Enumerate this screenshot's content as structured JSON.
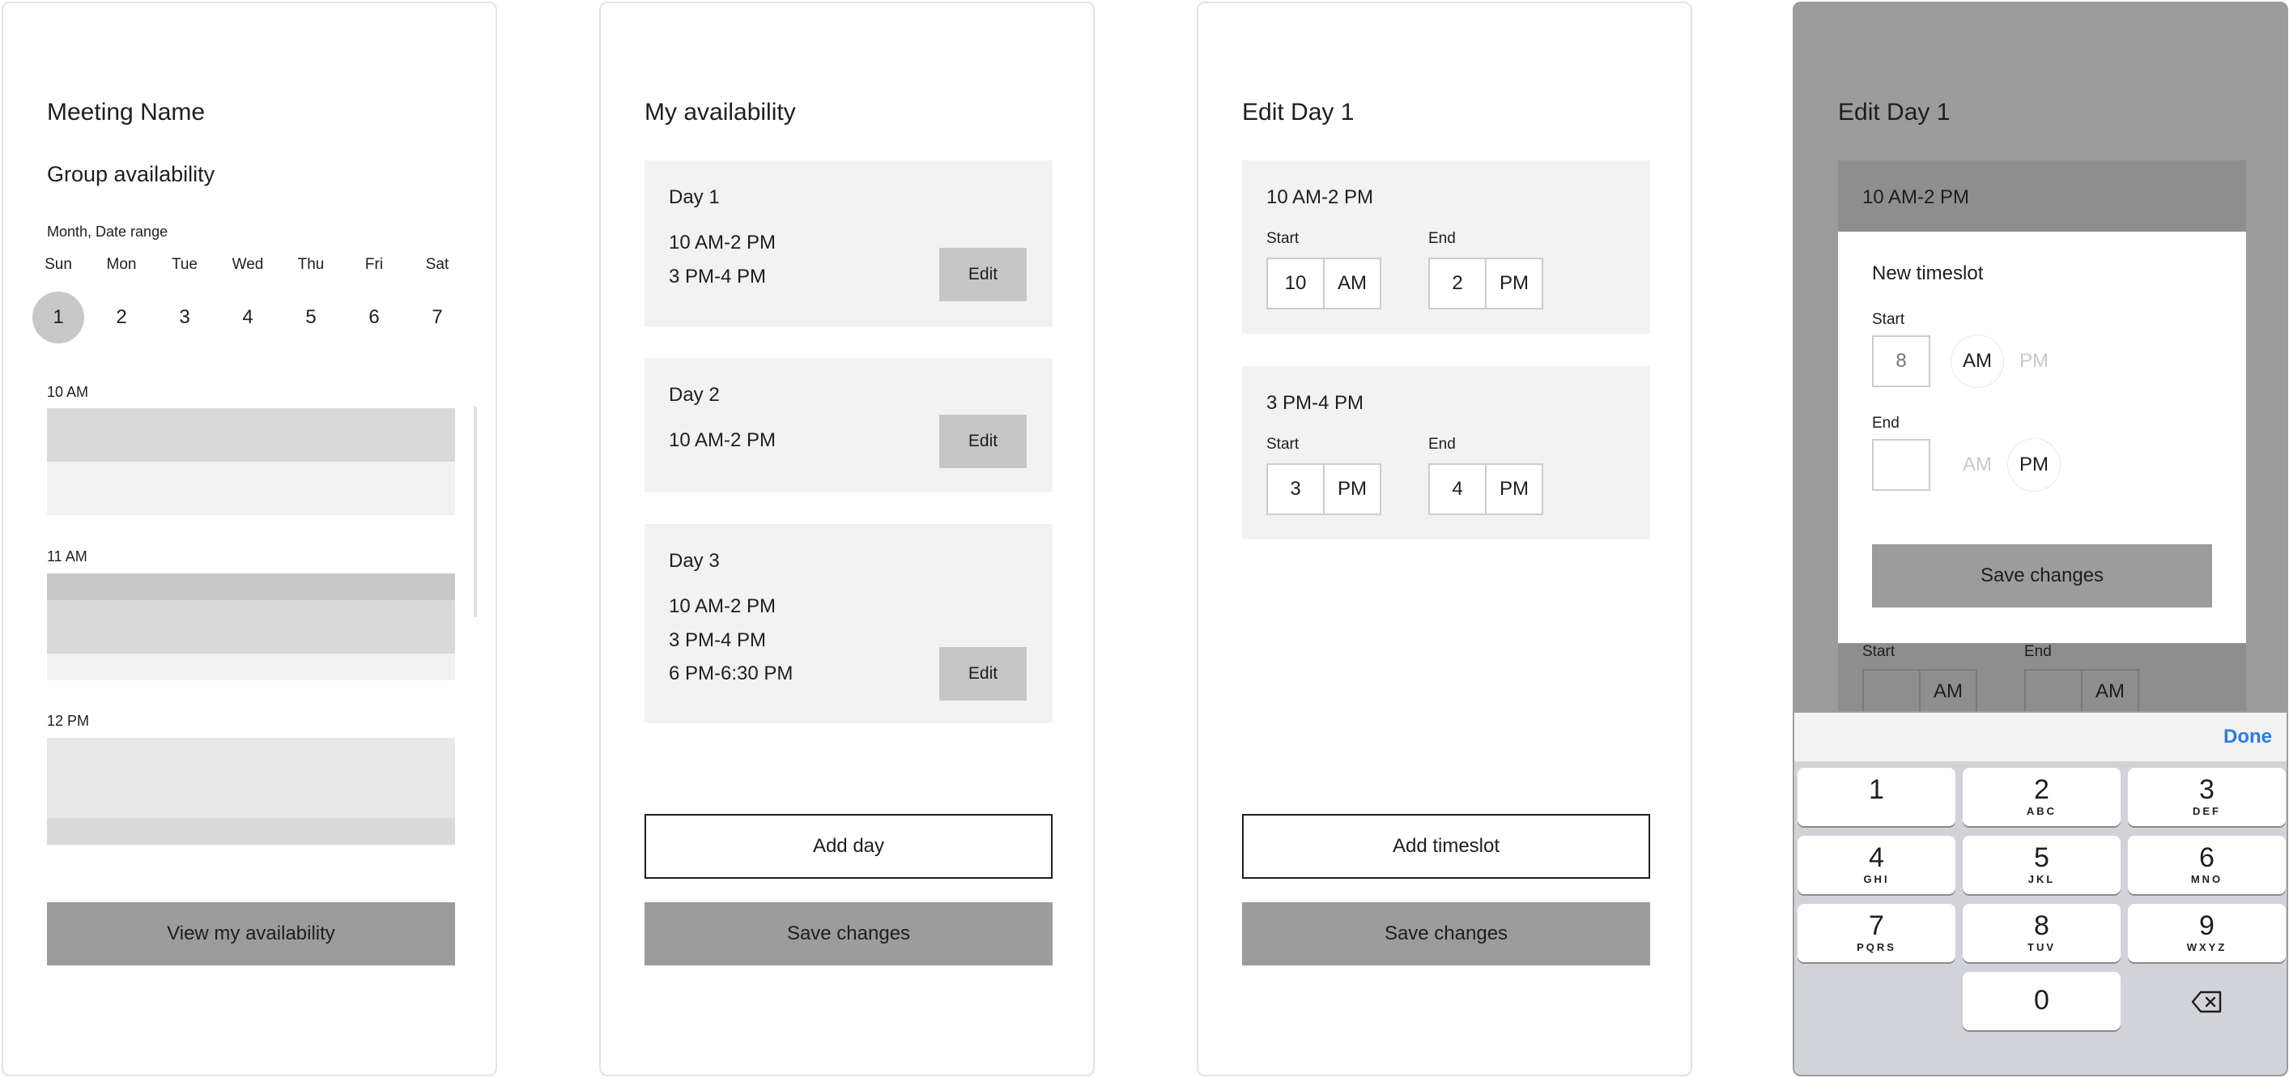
{
  "screen1": {
    "title": "Meeting Name",
    "subtitle": "Group availability",
    "range_label": "Month, Date range",
    "weekdays": [
      "Sun",
      "Mon",
      "Tue",
      "Wed",
      "Thu",
      "Fri",
      "Sat"
    ],
    "dates": [
      "1",
      "2",
      "3",
      "4",
      "5",
      "6",
      "7"
    ],
    "selected_date": "1",
    "hours": [
      "10 AM",
      "11 AM",
      "12 PM"
    ],
    "button": "View my availability"
  },
  "screen2": {
    "title": "My availability",
    "days": [
      {
        "name": "Day 1",
        "slots": [
          "10 AM-2 PM",
          "3 PM-4 PM"
        ],
        "edit": "Edit"
      },
      {
        "name": "Day 2",
        "slots": [
          "10 AM-2 PM"
        ],
        "edit": "Edit"
      },
      {
        "name": "Day 3",
        "slots": [
          "10 AM-2 PM",
          "3 PM-4 PM",
          "6 PM-6:30 PM"
        ],
        "edit": "Edit"
      }
    ],
    "add_button": "Add day",
    "save_button": "Save changes"
  },
  "screen3": {
    "title": "Edit Day 1",
    "slots": [
      {
        "label": "10 AM-2 PM",
        "start_label": "Start",
        "start_hour": "10",
        "start_period": "AM",
        "end_label": "End",
        "end_hour": "2",
        "end_period": "PM"
      },
      {
        "label": "3 PM-4 PM",
        "start_label": "Start",
        "start_hour": "3",
        "start_period": "PM",
        "end_label": "End",
        "end_hour": "4",
        "end_period": "PM"
      }
    ],
    "add_button": "Add timeslot",
    "save_button": "Save changes"
  },
  "screen4": {
    "title": "Edit Day 1",
    "slot_label": "10 AM-2 PM",
    "behind": {
      "start_label": "Start",
      "start_period": "AM",
      "end_label": "End",
      "end_period": "AM"
    },
    "modal": {
      "title": "New timeslot",
      "start_label": "Start",
      "start_value": "8",
      "start_am": "AM",
      "start_pm": "PM",
      "end_label": "End",
      "end_value": "",
      "end_am": "AM",
      "end_pm": "PM",
      "save_button": "Save changes"
    },
    "keyboard": {
      "done": "Done",
      "keys": [
        {
          "n": "1",
          "l": ""
        },
        {
          "n": "2",
          "l": "ABC"
        },
        {
          "n": "3",
          "l": "DEF"
        },
        {
          "n": "4",
          "l": "GHI"
        },
        {
          "n": "5",
          "l": "JKL"
        },
        {
          "n": "6",
          "l": "MNO"
        },
        {
          "n": "7",
          "l": "PQRS"
        },
        {
          "n": "8",
          "l": "TUV"
        },
        {
          "n": "9",
          "l": "WXYZ"
        },
        {
          "n": "0",
          "l": ""
        }
      ]
    }
  }
}
